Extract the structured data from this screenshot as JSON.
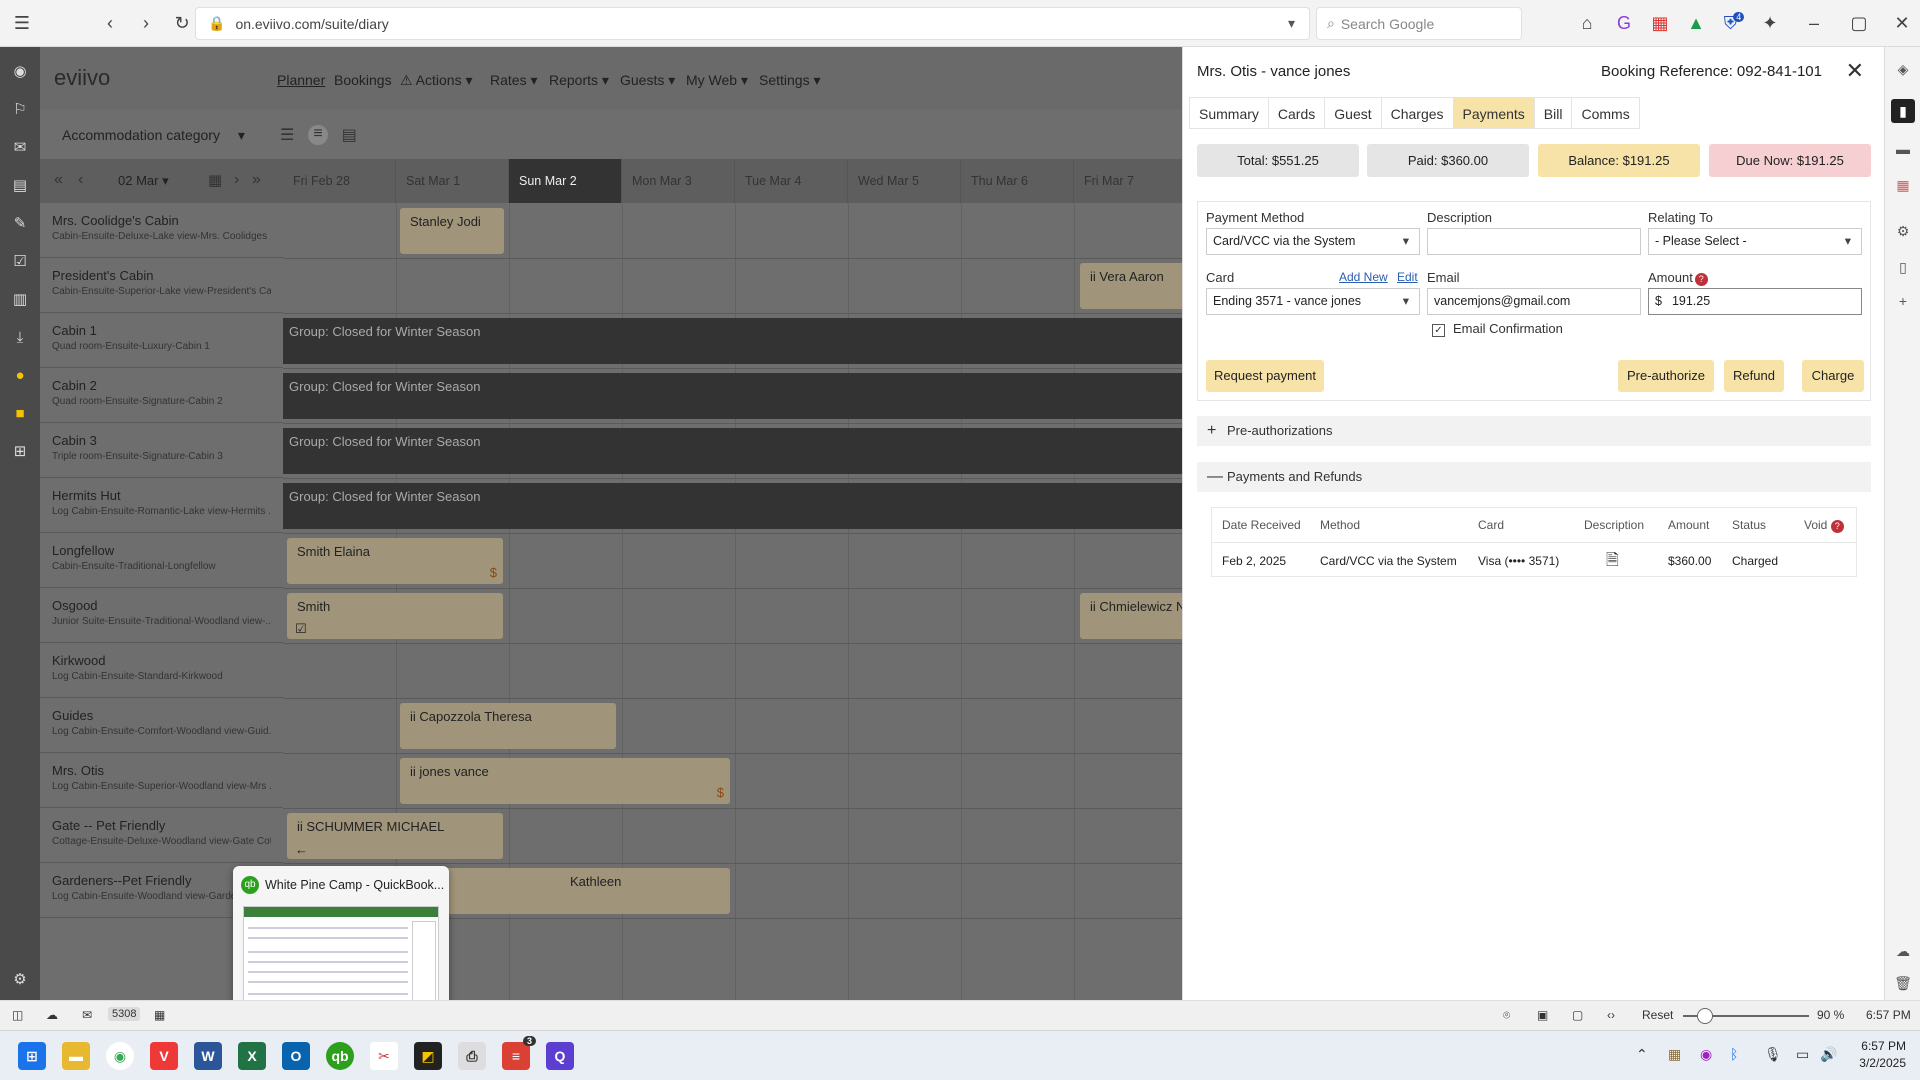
{
  "browser": {
    "url": "on.eviivo.com/suite/diary",
    "search_placeholder": "Search Google",
    "ext_badge": "4"
  },
  "app": {
    "logo": "eviivo",
    "nav": [
      "Planner",
      "Bookings",
      "Actions",
      "Rates",
      "Reports",
      "Guests",
      "My Web",
      "Settings"
    ],
    "category_select": "Accommodation category",
    "current_date": "02 Mar"
  },
  "planner": {
    "dates": [
      "Fri Feb 28",
      "Sat Mar 1",
      "Sun Mar 2",
      "Mon Mar 3",
      "Tue Mar 4",
      "Wed Mar 5",
      "Thu Mar 6",
      "Fri Mar 7"
    ],
    "rooms": [
      {
        "name": "Mrs. Coolidge's Cabin",
        "desc": "Cabin-Ensuite-Deluxe-Lake view-Mrs. Coolidges ..."
      },
      {
        "name": "President's Cabin",
        "desc": "Cabin-Ensuite-Superior-Lake view-President's Ca..."
      },
      {
        "name": "Cabin 1",
        "desc": "Quad room-Ensuite-Luxury-Cabin 1"
      },
      {
        "name": "Cabin 2",
        "desc": "Quad room-Ensuite-Signature-Cabin 2"
      },
      {
        "name": "Cabin 3",
        "desc": "Triple room-Ensuite-Signature-Cabin 3"
      },
      {
        "name": "Hermits Hut",
        "desc": "Log Cabin-Ensuite-Romantic-Lake view-Hermits ..."
      },
      {
        "name": "Longfellow",
        "desc": "Cabin-Ensuite-Traditional-Longfellow"
      },
      {
        "name": "Osgood",
        "desc": "Junior Suite-Ensuite-Traditional-Woodland view-..."
      },
      {
        "name": "Kirkwood",
        "desc": "Log Cabin-Ensuite-Standard-Kirkwood"
      },
      {
        "name": "Guides",
        "desc": "Log Cabin-Ensuite-Comfort-Woodland view-Guid..."
      },
      {
        "name": "Mrs. Otis",
        "desc": "Log Cabin-Ensuite-Superior-Woodland view-Mrs ..."
      },
      {
        "name": "Gate -- Pet Friendly",
        "desc": "Cottage-Ensuite-Deluxe-Woodland view-Gate Cot..."
      },
      {
        "name": "Gardeners--Pet Friendly",
        "desc": "Log Cabin-Ensuite-Woodland view-Garden..."
      }
    ],
    "bookings": [
      "Stanley Jodi",
      "Vera Aaron",
      "Smith Elaina",
      "Smith",
      "Chmielewicz N",
      "Capozzola Theresa",
      "jones vance",
      "SCHUMMER MICHAEL",
      "Kathleen"
    ],
    "closed_label": "Group: Closed for Winter Season",
    "dollar": "$"
  },
  "panel": {
    "title": "Mrs. Otis - vance jones",
    "booking_ref": "Booking Reference: 092-841-101",
    "tabs": [
      "Summary",
      "Cards",
      "Guest",
      "Charges",
      "Payments",
      "Bill",
      "Comms"
    ],
    "summary": {
      "total": "Total: $551.25",
      "paid": "Paid: $360.00",
      "balance": "Balance: $191.25",
      "due": "Due Now: $191.25"
    },
    "form": {
      "payment_method_label": "Payment Method",
      "payment_method": "Card/VCC via the System",
      "description_label": "Description",
      "relating_to_label": "Relating To",
      "relating_to": "- Please Select -",
      "card_label": "Card",
      "add_new": "Add New",
      "edit": "Edit",
      "card": "Ending 3571 - vance jones",
      "email_label": "Email",
      "email": "vancemjons@gmail.com",
      "amount_label": "Amount",
      "currency": "$",
      "amount": "191.25",
      "email_confirm": "Email Confirmation",
      "request_payment": "Request payment",
      "pre_authorize": "Pre-authorize",
      "refund": "Refund",
      "charge": "Charge"
    },
    "preauth_label": "Pre-authorizations",
    "payments_label": "Payments and Refunds",
    "table": {
      "headers": [
        "Date Received",
        "Method",
        "Card",
        "Description",
        "Amount",
        "Status",
        "Void"
      ],
      "row": [
        "Feb 2, 2025",
        "Card/VCC via the System",
        "Visa (•••• 3571)",
        "",
        "$360.00",
        "Charged"
      ]
    }
  },
  "statusbar": {
    "badge": "5308",
    "reset": "Reset",
    "zoom": "90 %",
    "time": "6:57 PM"
  },
  "taskbar": {
    "time": "6:57 PM",
    "date": "3/2/2025",
    "todoist_badge": "3"
  },
  "thumbnail": {
    "title": "White Pine Camp - QuickBook..."
  }
}
